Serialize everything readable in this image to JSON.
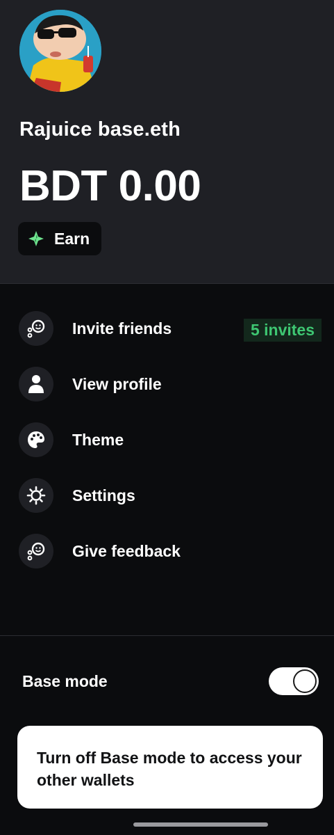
{
  "profile": {
    "name": "Rajuice base.eth",
    "balance": "BDT 0.00",
    "earn_label": "Earn"
  },
  "menu": {
    "items": [
      {
        "label": "Invite friends",
        "icon": "invite-friends-icon",
        "badge": "5 invites"
      },
      {
        "label": "View profile",
        "icon": "person-icon"
      },
      {
        "label": "Theme",
        "icon": "palette-icon"
      },
      {
        "label": "Settings",
        "icon": "gear-icon"
      },
      {
        "label": "Give feedback",
        "icon": "feedback-icon"
      }
    ]
  },
  "base_mode": {
    "label": "Base mode",
    "enabled": true,
    "notice": "Turn off Base mode to access your other wallets"
  },
  "colors": {
    "header_bg": "#1f2025",
    "page_bg": "#0b0c0e",
    "accent_green": "#3ec772",
    "earn_icon_green": "#6fe38f"
  }
}
